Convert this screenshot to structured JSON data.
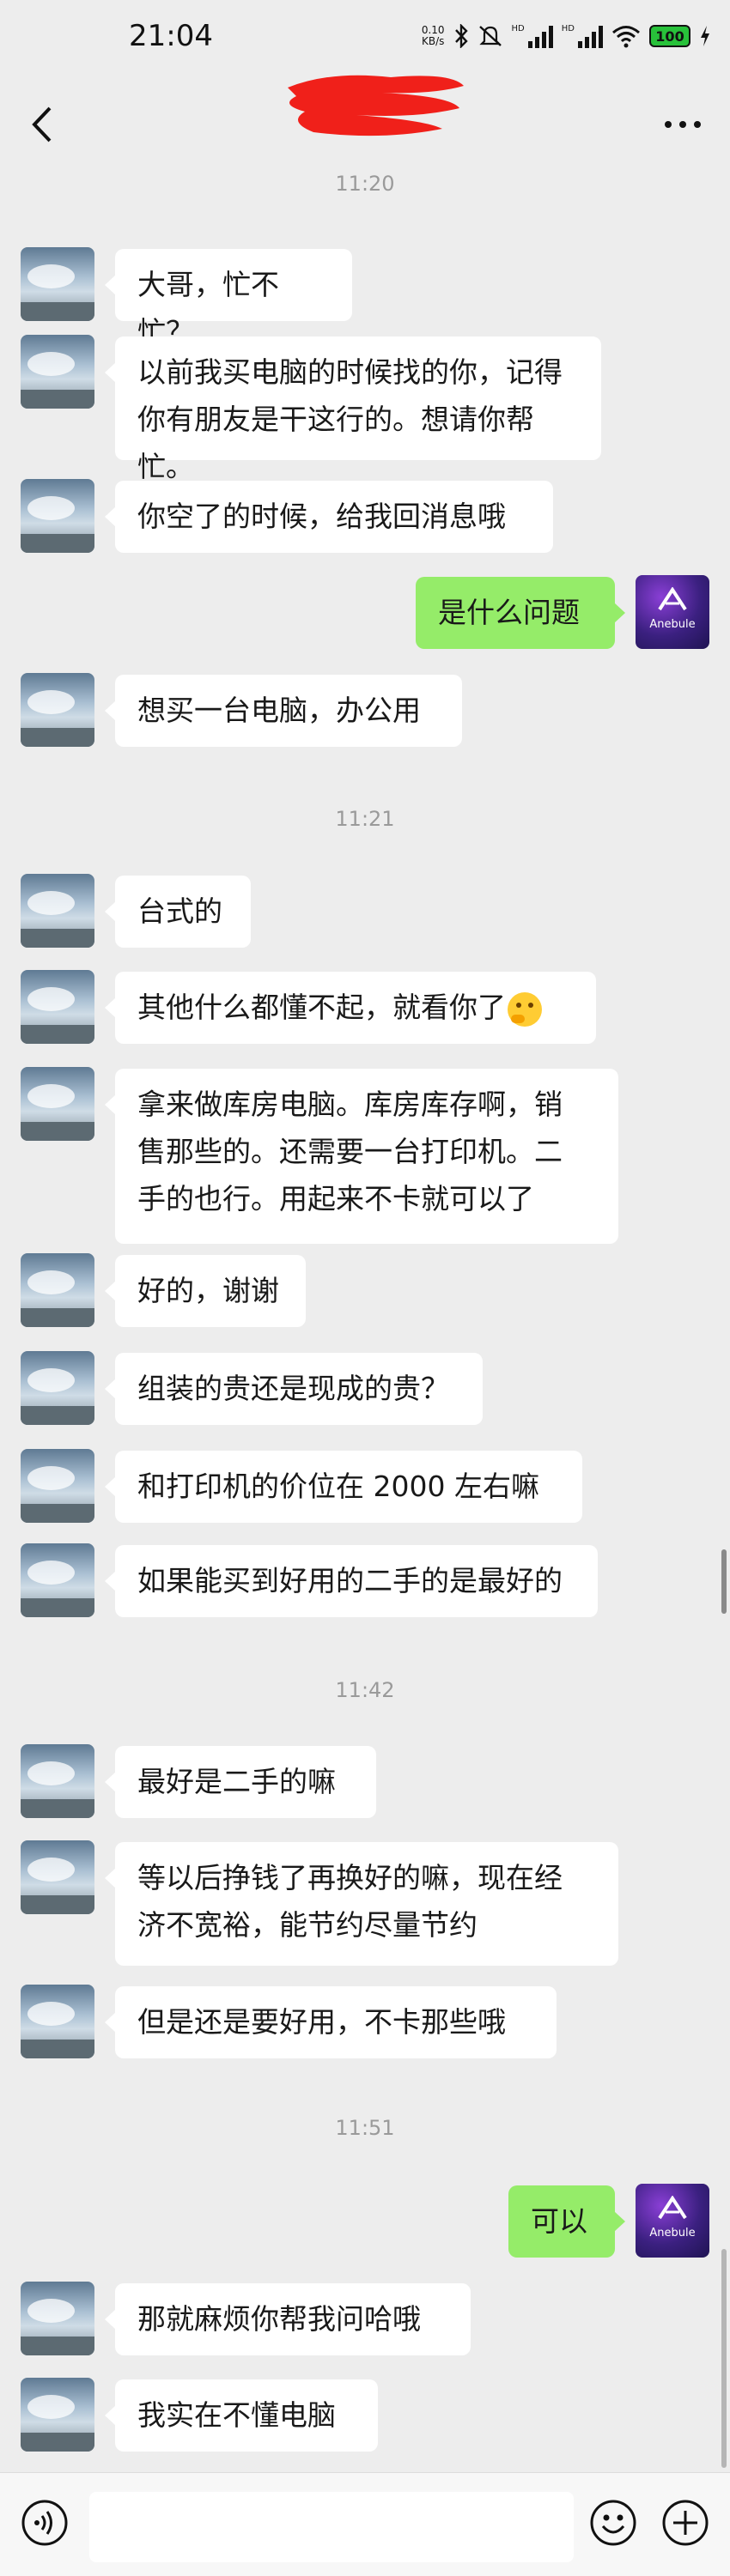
{
  "status_bar": {
    "time": "21:04",
    "net_speed_value": "0.10",
    "net_speed_unit": "KB/s",
    "hd_label": "HD",
    "battery": "100"
  },
  "header": {
    "title_redacted": true
  },
  "timestamps": [
    "11:20",
    "11:21",
    "11:42",
    "11:51"
  ],
  "messages": [
    {
      "side": "left",
      "text": "大哥，忙不忙？"
    },
    {
      "side": "left",
      "text": "以前我买电脑的时候找的你，记得\n你有朋友是干这行的。想请你帮忙。"
    },
    {
      "side": "left",
      "text": "你空了的时候，给我回消息哦"
    },
    {
      "side": "right",
      "text": "是什么问题"
    },
    {
      "side": "left",
      "text": "想买一台电脑，办公用"
    },
    {
      "side": "left",
      "text": "台式的"
    },
    {
      "side": "left",
      "text": "其他什么都懂不起，就看你了"
    },
    {
      "side": "left",
      "text": "拿来做库房电脑。库房库存啊，销\n售那些的。还需要一台打印机。二\n手的也行。用起来不卡就可以了"
    },
    {
      "side": "left",
      "text": "好的，谢谢"
    },
    {
      "side": "left",
      "text": "组装的贵还是现成的贵？"
    },
    {
      "side": "left",
      "text": "和打印机的价位在 2000 左右嘛"
    },
    {
      "side": "left",
      "text": "如果能买到好用的二手的是最好的"
    },
    {
      "side": "left",
      "text": "最好是二手的嘛"
    },
    {
      "side": "left",
      "text": "等以后挣钱了再换好的嘛，现在经\n济不宽裕，能节约尽量节约"
    },
    {
      "side": "left",
      "text": "但是还是要好用，不卡那些哦"
    },
    {
      "side": "right",
      "text": "可以"
    },
    {
      "side": "left",
      "text": "那就麻烦你帮我问哈哦"
    },
    {
      "side": "left",
      "text": "我实在不懂电脑"
    }
  ],
  "emoji": {
    "think": "thinking-face"
  },
  "avatar_right": {
    "logo_text": "Anebule"
  },
  "input": {
    "placeholder": ""
  },
  "colors": {
    "background": "#ededed",
    "sent_bubble": "#95ec69",
    "received_bubble": "#ffffff",
    "timestamp": "#9a9a9a"
  },
  "icons": [
    "back-arrow-icon",
    "more-dots-icon",
    "voice-icon",
    "emoji-smile-icon",
    "plus-icon",
    "bluetooth-icon",
    "mute-icon",
    "wifi-icon",
    "charging-icon"
  ]
}
